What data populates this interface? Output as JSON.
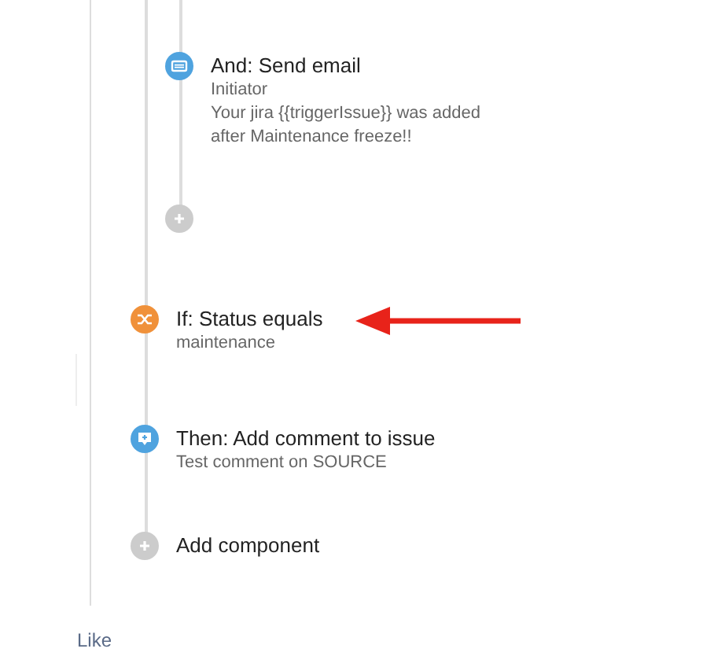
{
  "branch": {
    "steps": [
      {
        "kind": "email",
        "title": "And: Send email",
        "lines": [
          "Initiator",
          "Your jira {{triggerIssue}} was added",
          "after Maintenance freeze!!"
        ]
      },
      {
        "kind": "add"
      }
    ]
  },
  "steps": [
    {
      "kind": "condition",
      "title": "If: Status equals",
      "lines": [
        "maintenance"
      ],
      "annotated": true
    },
    {
      "kind": "comment",
      "title": "Then: Add comment to issue",
      "lines": [
        "Test comment on SOURCE"
      ],
      "annotated": false
    }
  ],
  "add_component": {
    "label": "Add component"
  },
  "like": {
    "label": "Like"
  }
}
